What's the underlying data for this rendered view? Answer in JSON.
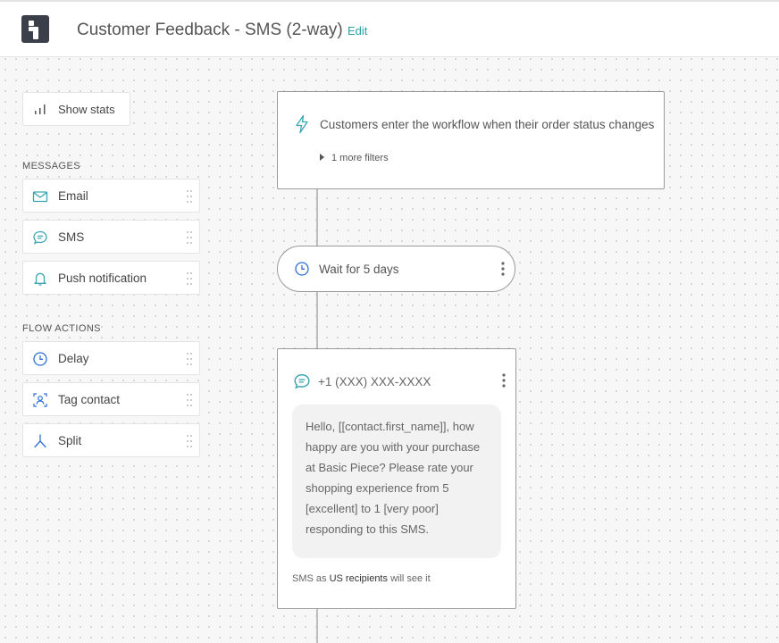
{
  "header": {
    "title": "Customer Feedback - SMS (2-way)",
    "edit_label": "Edit"
  },
  "sidebar": {
    "show_stats_label": "Show stats",
    "messages_heading": "MESSAGES",
    "messages": [
      {
        "label": "Email",
        "icon": "envelope-icon"
      },
      {
        "label": "SMS",
        "icon": "sms-bubble-icon"
      },
      {
        "label": "Push notification",
        "icon": "bell-icon"
      }
    ],
    "flow_actions_heading": "FLOW ACTIONS",
    "flow_actions": [
      {
        "label": "Delay",
        "icon": "clock-icon"
      },
      {
        "label": "Tag contact",
        "icon": "tag-contact-icon"
      },
      {
        "label": "Split",
        "icon": "split-icon"
      }
    ]
  },
  "workflow": {
    "trigger": {
      "text": "Customers enter the workflow when their order status changes",
      "filters_label": "1 more filters"
    },
    "delay": {
      "text": "Wait for 5 days"
    },
    "sms": {
      "phone": "+1 (XXX) XXX-XXXX",
      "message": "Hello, [[contact.first_name]], how happy are you with your purchase at Basic Piece? Please rate your shopping experience from 5 [excellent] to 1 [very poor] responding to this SMS.",
      "note_prefix": "SMS as",
      "note_emphasis": "US recipients",
      "note_suffix": "will see it"
    }
  },
  "colors": {
    "accent": "#2aa3a3",
    "icon": "#3aa6b3",
    "node_border": "#9a9a9a",
    "logo_bg": "#3a3f4a"
  }
}
